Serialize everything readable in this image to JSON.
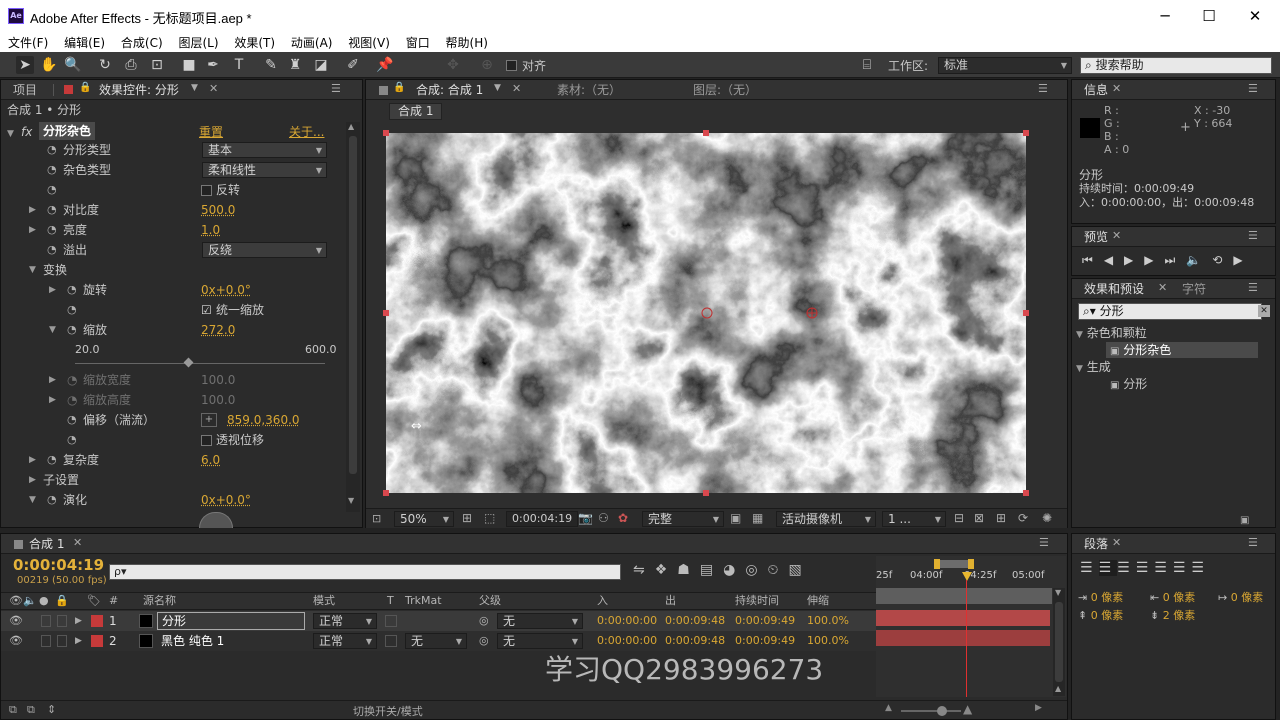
{
  "window": {
    "title": "Adobe After Effects - 无标题项目.aep *",
    "app_icon": "Ae",
    "minimize": "─",
    "maximize": "☐",
    "close": "✕"
  },
  "menu": [
    "文件(F)",
    "编辑(E)",
    "合成(C)",
    "图层(L)",
    "效果(T)",
    "动画(A)",
    "视图(V)",
    "窗口",
    "帮助(H)"
  ],
  "toolbar": {
    "snap_label": "对齐",
    "workspace_label": "工作区:",
    "workspace_value": "标准",
    "search_placeholder": "搜索帮助"
  },
  "effect_controls": {
    "tab_project": "项目",
    "tab_effect": "效果控件: 分形",
    "breadcrumb": "合成 1 • 分形",
    "effect_name": "分形杂色",
    "reset": "重置",
    "about": "关于...",
    "fractal_type_label": "分形类型",
    "fractal_type_value": "基本",
    "noise_type_label": "杂色类型",
    "noise_type_value": "柔和线性",
    "invert_label": "反转",
    "contrast_label": "对比度",
    "contrast_value": "500.0",
    "brightness_label": "亮度",
    "brightness_value": "1.0",
    "overflow_label": "溢出",
    "overflow_value": "反绕",
    "transform_label": "变换",
    "rotation_label": "旋转",
    "rotation_value": "0x+0.0°",
    "uniform_scale_label": "统一缩放",
    "scale_label": "缩放",
    "scale_value": "272.0",
    "scale_min": "20.0",
    "scale_max": "600.0",
    "scale_width_label": "缩放宽度",
    "scale_width_value": "100.0",
    "scale_height_label": "缩放高度",
    "scale_height_value": "100.0",
    "offset_label": "偏移（湍流）",
    "offset_value": "859.0,360.0",
    "perspective_label": "透视位移",
    "complexity_label": "复杂度",
    "complexity_value": "6.0",
    "sub_settings_label": "子设置",
    "evolution_label": "演化",
    "evolution_value": "0x+0.0°"
  },
  "viewer": {
    "tab_comp": "合成: 合成 1",
    "tab_footage": "素材:（无）",
    "tab_layer": "图层:（无）",
    "comp_chip": "合成 1",
    "zoom": "50%",
    "timecode": "0:00:04:19",
    "resolution": "完整",
    "camera": "活动摄像机",
    "views": "1 ..."
  },
  "info": {
    "tab": "信息",
    "r": "R :",
    "g": "G :",
    "b": "B :",
    "a": "A : 0",
    "x": "X : -30",
    "y": "Y : 664",
    "layer_name": "分形",
    "duration": "持续时间：0:00:09:49",
    "in_out": "入：0:00:00:00，出：0:00:09:48"
  },
  "preview": {
    "tab": "预览"
  },
  "effects_presets": {
    "tab": "效果和预设",
    "tab2": "字符",
    "search_value": "分形",
    "category1": "杂色和颗粒",
    "item1": "分形杂色",
    "category2": "生成",
    "item2": "分形"
  },
  "timeline": {
    "tab": "合成 1",
    "timecode": "0:00:04:19",
    "frame_info": "00219 (50.00 fps)",
    "search_placeholder": "ρ▾",
    "col_num": "#",
    "col_source": "源名称",
    "col_mode": "模式",
    "col_t": "T",
    "col_trkmat": "TrkMat",
    "col_parent": "父级",
    "col_in": "入",
    "col_out": "出",
    "col_duration": "持续时间",
    "col_stretch": "伸缩",
    "ruler": [
      "25f",
      "04:00f",
      "04:25f",
      "05:00f"
    ],
    "toggle_label": "切换开关/模式",
    "layers": [
      {
        "num": "1",
        "name": "分形",
        "mode": "正常",
        "trkmat": "",
        "parent": "无",
        "in": "0:00:00:00",
        "out": "0:00:09:48",
        "duration": "0:00:09:49",
        "stretch": "100.0%"
      },
      {
        "num": "2",
        "name": "黑色 纯色 1",
        "mode": "正常",
        "trkmat": "无",
        "parent": "无",
        "in": "0:00:00:00",
        "out": "0:00:09:48",
        "duration": "0:00:09:49",
        "stretch": "100.0%"
      }
    ]
  },
  "paragraph": {
    "tab": "段落",
    "px1": "0 像素",
    "px2": "0 像素",
    "px3": "0 像素",
    "px4": "0 像素",
    "px5": "2 像素"
  },
  "watermark": "学习QQ2983996273",
  "colors": {
    "accent_yellow": "#d9a733",
    "layer_label_red": "#c63a3a",
    "bar_red": "#b34848",
    "cti_red": "#e03030"
  }
}
